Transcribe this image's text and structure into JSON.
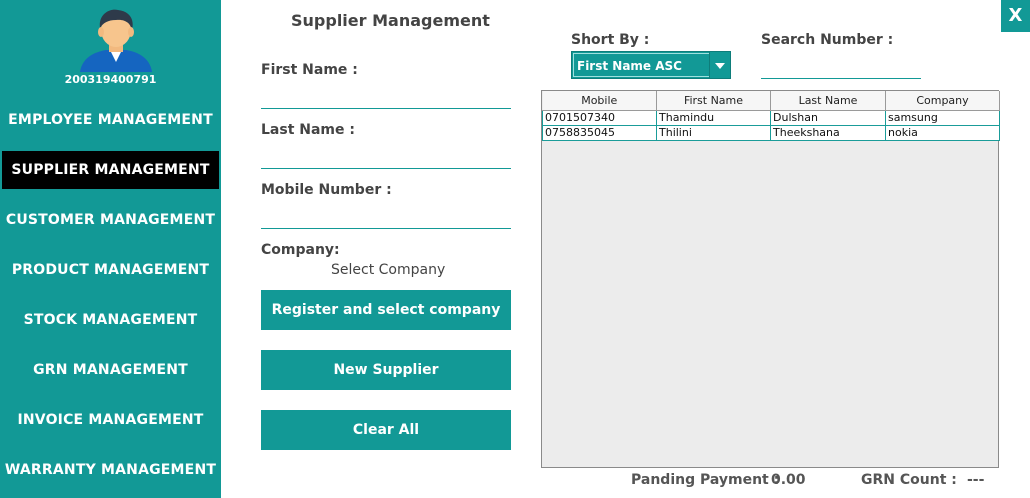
{
  "user": {
    "id": "200319400791"
  },
  "sidebar": {
    "items": [
      {
        "label": "EMPLOYEE MANAGEMENT"
      },
      {
        "label": "SUPPLIER MANAGEMENT"
      },
      {
        "label": "CUSTOMER MANAGEMENT"
      },
      {
        "label": "PRODUCT MANAGEMENT"
      },
      {
        "label": "STOCK MANAGEMENT"
      },
      {
        "label": "GRN MANAGEMENT"
      },
      {
        "label": "INVOICE MANAGEMENT"
      },
      {
        "label": "WARRANTY MANAGEMENT"
      }
    ],
    "active": "SUPPLIER MANAGEMENT"
  },
  "form": {
    "title": "Supplier Management",
    "first_name_label": "First Name :",
    "first_name_value": "",
    "last_name_label": "Last Name :",
    "last_name_value": "",
    "mobile_label": "Mobile Number :",
    "mobile_value": "",
    "company_label": "Company:",
    "company_value": "Select Company",
    "register_button": "Register and select company",
    "new_button": "New Supplier",
    "clear_button": "Clear All"
  },
  "sort": {
    "label": "Short By  :",
    "selected": "First Name ASC"
  },
  "search": {
    "label": "Search Number :",
    "value": ""
  },
  "table": {
    "columns": [
      "Mobile",
      "First Name",
      "Last Name",
      "Company"
    ],
    "rows": [
      [
        "0701507340",
        "Thamindu",
        "Dulshan",
        "samsung"
      ],
      [
        "0758835045",
        "Thilini",
        "Theekshana",
        "nokia"
      ]
    ]
  },
  "footer": {
    "pending_label": "Panding Payment :",
    "pending_value": "0.00",
    "grn_label": "GRN Count :",
    "grn_value": "---"
  },
  "window": {
    "close_label": "X"
  },
  "colors": {
    "accent": "#129996",
    "active_nav": "#000000"
  },
  "icons": {
    "avatar": "user-avatar-icon",
    "dropdown": "chevron-down-icon"
  }
}
